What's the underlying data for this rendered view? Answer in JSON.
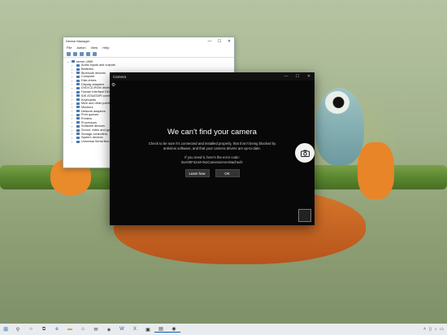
{
  "device_manager": {
    "title": "Device Manager",
    "menu": [
      "File",
      "Action",
      "View",
      "Help"
    ],
    "root": "server-1965",
    "items": [
      "Audio inputs and outputs",
      "Batteries",
      "Bluetooth devices",
      "Computer",
      "Disk drives",
      "Display adapters",
      "DVD/CD-ROM drives",
      "Human Interface Devices",
      "IDE ATA/ATAPI controllers",
      "Keyboards",
      "Mice and other pointing devices",
      "Monitors",
      "Network adapters",
      "Print queues",
      "Printers",
      "Processors",
      "Software devices",
      "Sound, video and game controllers",
      "Storage controllers",
      "System devices",
      "Universal Serial Bus controllers"
    ],
    "controls": {
      "minimize": "—",
      "maximize": "☐",
      "close": "✕"
    }
  },
  "camera": {
    "title": "Camera",
    "heading": "We can't find your camera",
    "body": "Check to be sure it's connected and installed properly, that it isn't being blocked by antivirus software, and that your camera drivers are up-to-date.",
    "error_intro": "If you need it, here's the error code:",
    "error_code": "0xA00F4244<NoCamerasAreAttached>",
    "learn_button": "Learn how",
    "ok_button": "OK",
    "controls": {
      "minimize": "—",
      "maximize": "☐",
      "close": "✕"
    }
  },
  "taskbar": {
    "tray_time": "10:00 AM",
    "tray_date": "5/3/2018"
  },
  "colors": {
    "accent": "#0b62b8",
    "camera_bg": "#080808"
  }
}
